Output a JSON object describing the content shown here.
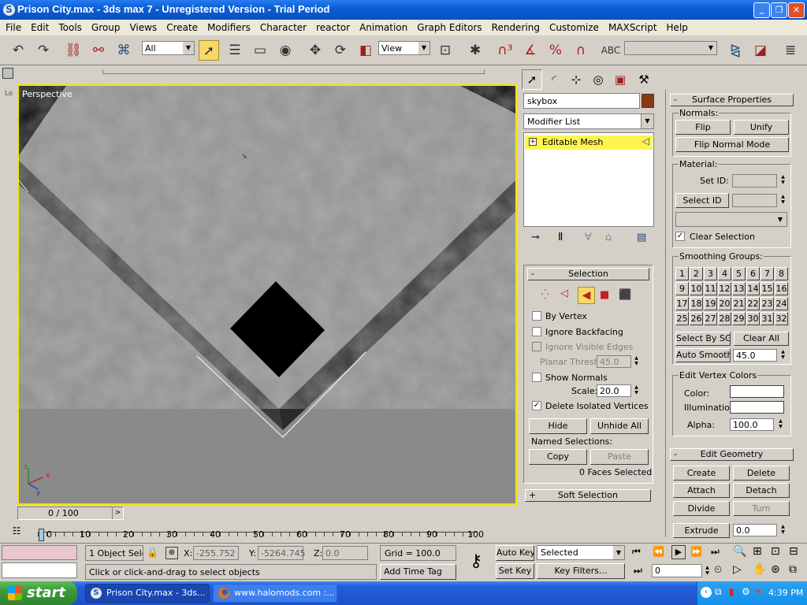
{
  "window": {
    "title": "Prison City.max - 3ds max 7  - Unregistered Version - Trial Period"
  },
  "menu": [
    "File",
    "Edit",
    "Tools",
    "Group",
    "Views",
    "Create",
    "Modifiers",
    "Character",
    "reactor",
    "Animation",
    "Graph Editors",
    "Rendering",
    "Customize",
    "MAXScript",
    "Help"
  ],
  "toolbar": {
    "filter_value": "All",
    "refcoord_value": "View"
  },
  "viewport": {
    "label": "Perspective",
    "side_label": "Le"
  },
  "cmd_panel": {
    "object_name": "skybox",
    "modifier_list_label": "Modifier List",
    "stack_item": "Editable Mesh",
    "expand_glyph": "+"
  },
  "selection": {
    "title": "Selection",
    "by_vertex": "By Vertex",
    "ignore_backfacing": "Ignore Backfacing",
    "ignore_visible_edges": "Ignore Visible Edges",
    "planar_thresh_label": "Planar Thresh:",
    "planar_thresh_value": "45.0",
    "show_normals": "Show Normals",
    "scale_label": "Scale:",
    "scale_value": "20.0",
    "delete_isolated": "Delete Isolated Vertices",
    "hide": "Hide",
    "unhide_all": "Unhide All",
    "named_selections": "Named Selections:",
    "copy": "Copy",
    "paste": "Paste",
    "status": "0 Faces Selected",
    "soft_selection": "Soft Selection"
  },
  "surface": {
    "title": "Surface Properties",
    "normals_label": "Normals:",
    "flip": "Flip",
    "unify": "Unify",
    "flip_normal_mode": "Flip Normal Mode",
    "material_label": "Material:",
    "set_id": "Set ID:",
    "select_id": "Select ID",
    "clear_selection": "Clear Selection",
    "smoothing_groups": "Smoothing Groups:",
    "sg_numbers": [
      "1",
      "2",
      "3",
      "4",
      "5",
      "6",
      "7",
      "8",
      "9",
      "10",
      "11",
      "12",
      "13",
      "14",
      "15",
      "16",
      "17",
      "18",
      "19",
      "20",
      "21",
      "22",
      "23",
      "24",
      "25",
      "26",
      "27",
      "28",
      "29",
      "30",
      "31",
      "32"
    ],
    "select_by_sg": "Select By SG",
    "clear_all": "Clear All",
    "auto_smooth": "Auto Smooth",
    "auto_smooth_value": "45.0",
    "edit_vertex_colors": "Edit Vertex Colors",
    "color": "Color:",
    "illumination": "Illumination:",
    "alpha": "Alpha:",
    "alpha_value": "100.0"
  },
  "edit_geometry": {
    "title": "Edit Geometry",
    "create": "Create",
    "delete": "Delete",
    "attach": "Attach",
    "detach": "Detach",
    "divide": "Divide",
    "turn": "Turn",
    "extrude": "Extrude",
    "extrude_value": "0.0"
  },
  "timeline": {
    "frame": "0 / 100",
    "ticks": [
      "0",
      "10",
      "20",
      "30",
      "40",
      "50",
      "60",
      "70",
      "80",
      "90",
      "100"
    ]
  },
  "status": {
    "objects_selected": "1 Object Sele",
    "x_label": "X:",
    "x_value": "-255.752",
    "y_label": "Y:",
    "y_value": "-5264.745",
    "z_label": "Z:",
    "z_value": "0.0",
    "grid": "Grid = 100.0",
    "prompt": "Click or click-and-drag to select objects",
    "add_time_tag": "Add Time Tag",
    "auto_key": "Auto Key",
    "set_key": "Set Key",
    "key_mode": "Selected",
    "key_filters": "Key Filters...",
    "current_frame": "0"
  },
  "taskbar": {
    "start": "start",
    "task1": "Prison City.max - 3ds...",
    "task2": "www.halomods.com :...",
    "clock": "4:39 PM"
  },
  "colors": {
    "title_bar": "#0a5fd8",
    "taskbar": "#245edb",
    "start_button": "#3a9a3a",
    "stack_highlight": "#fff44f",
    "viewport_border": "#f5e600",
    "object_color": "#8a3a10"
  }
}
